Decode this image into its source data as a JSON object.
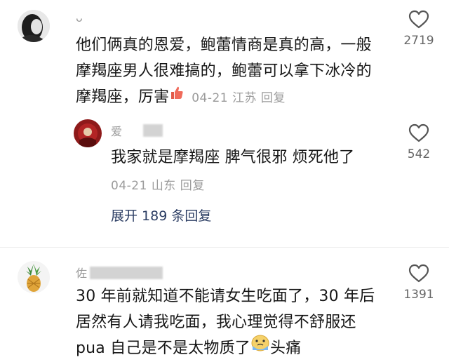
{
  "comments": [
    {
      "name": "ᴗ",
      "lines": [
        "他们俩真的恩爱，鲍蕾情商是真的高，一般",
        "摩羯座男人很难搞的，鲍蕾可以拿下冰冷的",
        "摩羯座，厉害"
      ],
      "emoji": "thumbs-up-icon",
      "date": "04-21",
      "location": "江苏",
      "reply_label": "回复",
      "likes": "2719"
    },
    {
      "name": "爱",
      "lines": [
        "我家就是摩羯座 脾气很邪 烦死他了"
      ],
      "date": "04-21",
      "location": "山东",
      "reply_label": "回复",
      "likes": "542"
    },
    {
      "expand_label": "展开 189 条回复"
    },
    {
      "name": "佐",
      "lines": [
        "30 年前就知道不能请女生吃面了，30 年后",
        "居然有人请我吃面，我心理觉得不舒服还",
        "pua 自己是不是太物质了"
      ],
      "emoji": "crying-face-icon",
      "tail": "头痛",
      "likes": "1391"
    }
  ],
  "colors": {
    "text": "#161616",
    "meta": "#9b9b9b",
    "link": "#2b3d63"
  }
}
